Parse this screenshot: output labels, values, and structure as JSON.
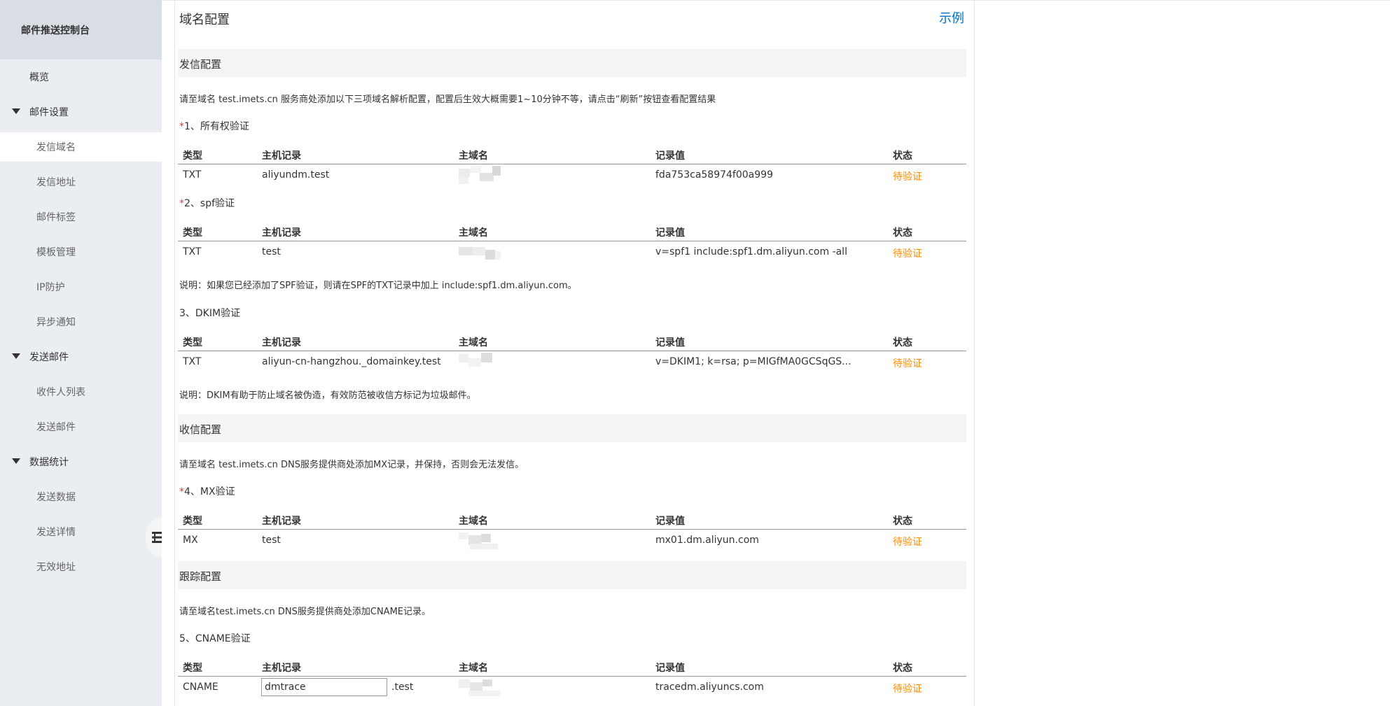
{
  "sidebar": {
    "title": "邮件推送控制台",
    "overview": "概览",
    "groups": [
      {
        "label": "邮件设置",
        "items": [
          "发信域名",
          "发信地址",
          "邮件标签",
          "模板管理",
          "IP防护",
          "异步通知"
        ]
      },
      {
        "label": "发送邮件",
        "items": [
          "收件人列表",
          "发送邮件"
        ]
      },
      {
        "label": "数据统计",
        "items": [
          "发送数据",
          "发送详情",
          "无效地址"
        ]
      }
    ],
    "active_item": "发信域名"
  },
  "page": {
    "title": "域名配置",
    "example_link": "示例"
  },
  "table_headers": [
    "类型",
    "主机记录",
    "主域名",
    "记录值",
    "状态"
  ],
  "send_config": {
    "title": "发信配置",
    "instruction": "请至域名 test.imets.cn 服务商处添加以下三项域名解析配置，配置后生效大概需要1~10分钟不等，请点击“刷新”按钮查看配置结果",
    "steps": [
      {
        "star": "*",
        "label": "1、所有权验证",
        "row": {
          "type": "TXT",
          "host": "aliyundm.test",
          "value": "fda753ca58974f00a999",
          "status": "待验证"
        }
      },
      {
        "star": "*",
        "label": "2、spf验证",
        "row": {
          "type": "TXT",
          "host": "test",
          "value": "v=spf1 include:spf1.dm.aliyun.com -all",
          "status": "待验证"
        }
      },
      {
        "star": "",
        "label": "3、DKIM验证",
        "row": {
          "type": "TXT",
          "host": "aliyun-cn-hangzhou._domainkey.test",
          "value": "v=DKIM1; k=rsa; p=MIGfMA0GCSqGS...",
          "status": "待验证"
        }
      }
    ],
    "spf_note": "说明：如果您已经添加了SPF验证，则请在SPF的TXT记录中加上 include:spf1.dm.aliyun.com。",
    "dkim_note": "说明：DKIM有助于防止域名被伪造，有效防范被收信方标记为垃圾邮件。"
  },
  "receive_config": {
    "title": "收信配置",
    "instruction": "请至域名 test.imets.cn DNS服务提供商处添加MX记录，并保持，否则会无法发信。",
    "step": {
      "star": "*",
      "label": "4、MX验证",
      "row": {
        "type": "MX",
        "host": "test",
        "value": "mx01.dm.aliyun.com",
        "status": "待验证"
      }
    }
  },
  "tracking_config": {
    "title": "跟踪配置",
    "instruction": "请至域名test.imets.cn DNS服务提供商处添加CNAME记录。",
    "step": {
      "label": "5、CNAME验证",
      "row": {
        "type": "CNAME",
        "host_input": "dmtrace",
        "host_suffix": ".test",
        "value": "tracedm.aliyuncs.com",
        "status": "待验证"
      }
    }
  }
}
